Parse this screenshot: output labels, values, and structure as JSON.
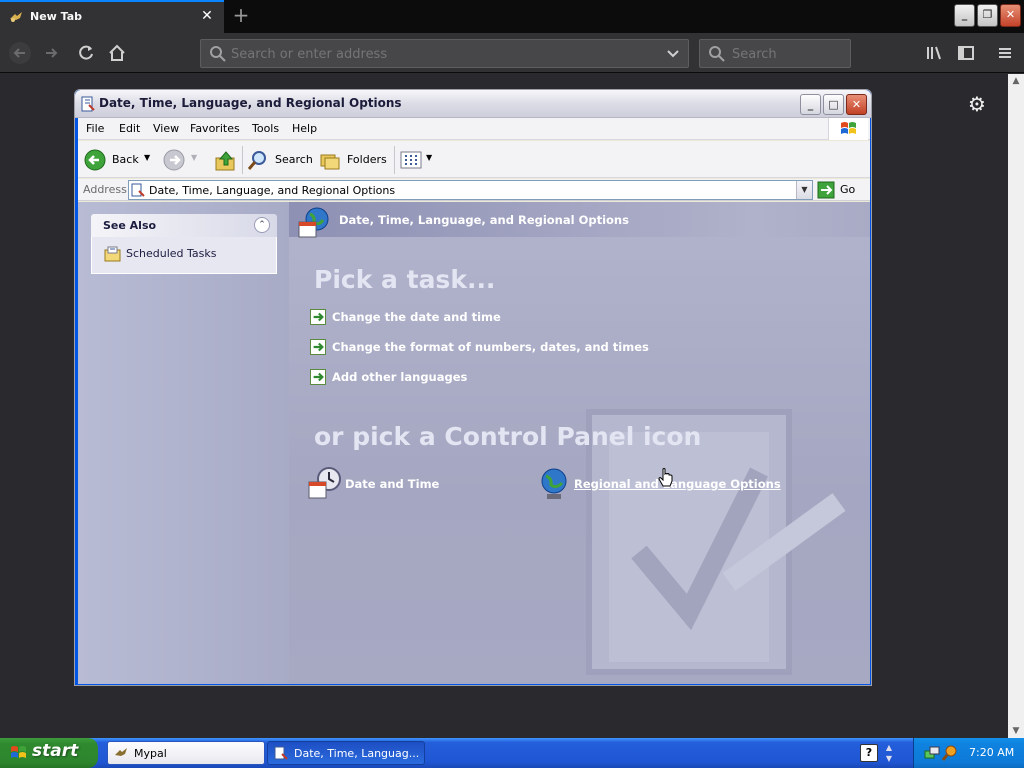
{
  "browser": {
    "tab": {
      "title": "New Tab"
    },
    "urlbar": {
      "placeholder": "Search or enter address"
    },
    "searchbar": {
      "placeholder": "Search"
    }
  },
  "window": {
    "title": "Date, Time, Language, and Regional Options",
    "menu": [
      "File",
      "Edit",
      "View",
      "Favorites",
      "Tools",
      "Help"
    ],
    "toolbar": {
      "back": "Back",
      "search": "Search",
      "folders": "Folders"
    },
    "address": {
      "label": "Address",
      "value": "Date, Time, Language, and Regional Options",
      "go": "Go"
    },
    "sidebar": {
      "see_also_title": "See Also",
      "items": [
        "Scheduled Tasks"
      ]
    },
    "main": {
      "header": "Date, Time, Language, and Regional Options",
      "pick_task": "Pick a task...",
      "tasks": [
        "Change the date and time",
        "Change the format of numbers, dates, and times",
        "Add other languages"
      ],
      "pick_icon": "or pick a Control Panel icon",
      "icons": [
        "Date and Time",
        "Regional and Language Options"
      ]
    }
  },
  "taskbar": {
    "start": "start",
    "tasks": [
      "Mypal",
      "Date, Time, Languag..."
    ],
    "clock": "7:20 AM"
  },
  "colors": {
    "accent_blue": "#0a84ff",
    "xp_green": "#2f8a2f",
    "panel_lavender": "#a9abc7"
  }
}
